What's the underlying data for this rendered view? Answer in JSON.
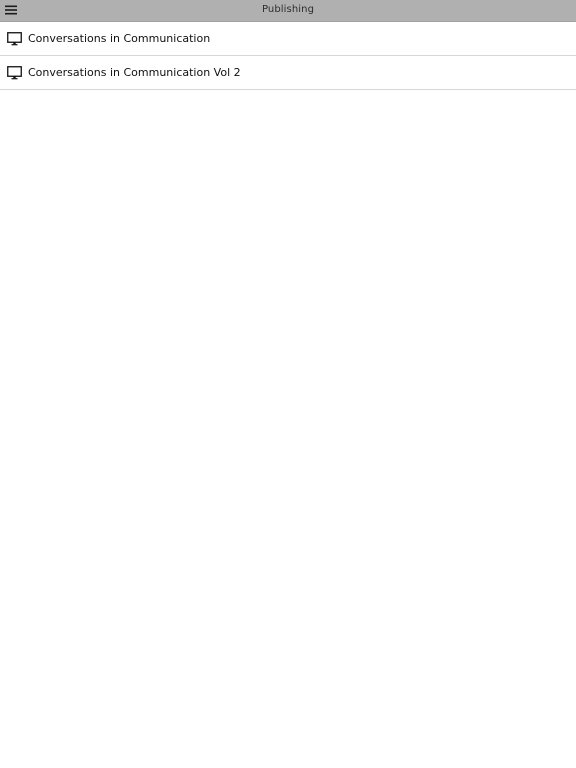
{
  "header": {
    "title": "Publishing",
    "menu_icon": "hamburger-menu-icon",
    "background_color": "#b0b0b0"
  },
  "list": {
    "items": [
      {
        "label": "Conversations in Communication",
        "icon": "monitor-icon"
      },
      {
        "label": "Conversations in Communication Vol 2",
        "icon": "monitor-icon"
      }
    ]
  }
}
